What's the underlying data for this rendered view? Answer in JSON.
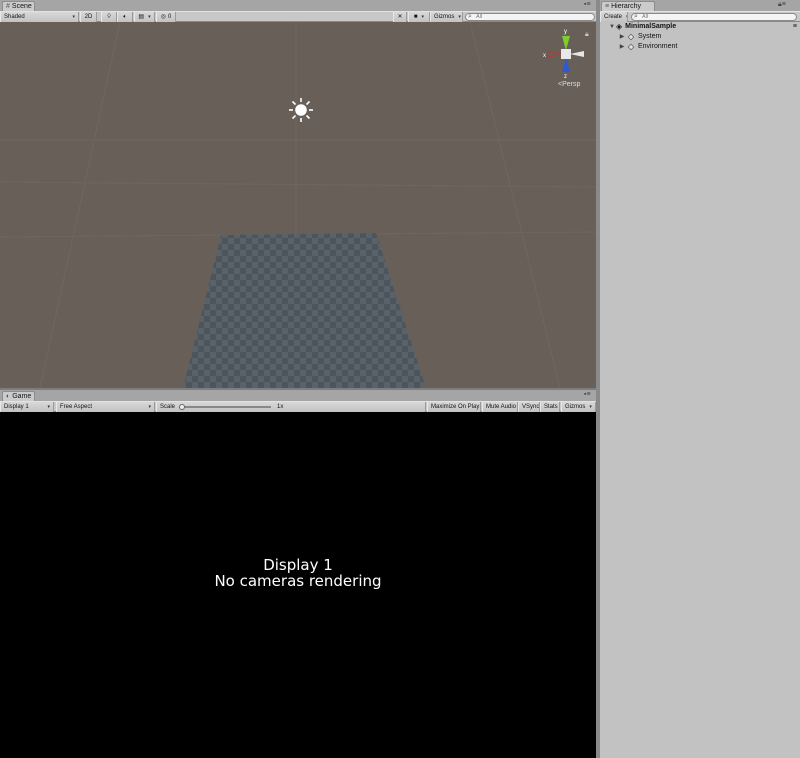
{
  "scene": {
    "tab_label": "Scene",
    "tab_icon": "scene-icon",
    "draw_mode": "Shaded",
    "mode_2d": "2D",
    "effects_count": "0",
    "gizmos_label": "Gizmos",
    "search_placeholder": "All",
    "gizmo_projection": "Persp",
    "gizmo_axis_x": "x",
    "gizmo_axis_y": "y",
    "gizmo_axis_z": "z",
    "background_color": "#686058",
    "floor_color": "#4f575e"
  },
  "game": {
    "tab_label": "Game",
    "tab_icon": "game-icon",
    "display": "Display 1",
    "aspect": "Free Aspect",
    "scale_label": "Scale",
    "scale_value": "1x",
    "scale_level": 0,
    "maximize_on_play": "Maximize On Play",
    "mute_audio": "Mute Audio",
    "vsync": "VSync",
    "stats": "Stats",
    "gizmos_label": "Gizmos",
    "message_line1": "Display 1",
    "message_line2": "No cameras rendering"
  },
  "hierarchy": {
    "tab_label": "Hierarchy",
    "tab_icon": "hierarchy-icon",
    "create_label": "Create",
    "search_placeholder": "All",
    "scene_name": "MinimalSample",
    "items": [
      {
        "label": "System"
      },
      {
        "label": "Environment"
      }
    ]
  }
}
